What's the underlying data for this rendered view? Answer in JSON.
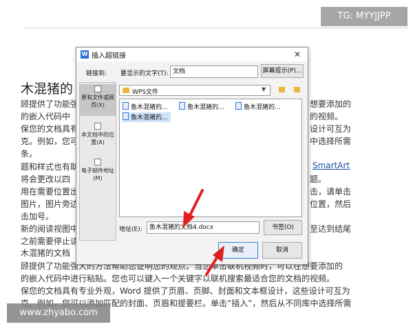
{
  "document": {
    "title": "木混猪的",
    "lines": [
      "顾提供了功能强",
      "的嵌入代码中",
      "保您的文档具有",
      "克。例如，您可",
      "条。",
      "题和样式也有助",
      "将会更改以四",
      "用在需要位置出",
      "图片，图片旁边",
      "击加号。",
      "新的阅读视图中",
      "之前需要停止读",
      "木混猪的文档",
      "顾提供了功能强大的方法帮助您证明您的观点。当您单击联机视频时，可以在想要添加的",
      "的嵌入代码中进行粘贴。您也可以键入一个关键字以联机搜索最适合您的文档的视频。",
      "保您的文档具有专业外观，Word 提供了页眉、页脚、封面和文本框设计，这些设计可互为",
      "克。例如，您可以添加匹配的封面、页眉和提要栏。单击“插入”，然后从不同库中选择所需"
    ],
    "right_fragments": [
      "想要添加的",
      "的视频。",
      "设计可互为",
      "中选择所需",
      "SmartArt",
      "题。",
      "击，请单击",
      "位置，然后",
      "至达到结尾"
    ]
  },
  "watermarks": {
    "tg": "TG: MYYJJPP",
    "site": "www.zhyabo.com"
  },
  "dialog": {
    "title": "插入超链接",
    "link_to_label": "链接到:",
    "display_text_label": "要显示的文字(T):",
    "display_text_value": "文档",
    "screen_tip_button": "屏幕提示(P)...",
    "panel_items": [
      {
        "label": "原有文件或网页(X)",
        "icon": "globe-file-icon",
        "selected": true
      },
      {
        "label": "本文档中的位置(A)",
        "icon": "bookmark-icon",
        "selected": false
      },
      {
        "label": "电子邮件地址(M)",
        "icon": "mail-icon",
        "selected": false
      }
    ],
    "folder": "WPS文件",
    "files": [
      {
        "name": "鱼木混猪的...",
        "selected": false
      },
      {
        "name": "鱼木混猪的...",
        "selected": false
      },
      {
        "name": "鱼木混猪的...",
        "selected": false
      },
      {
        "name": "鱼木混猪的...",
        "selected": true
      }
    ],
    "address_label": "地址(E):",
    "address_value": "鱼木混猪的文档4.docx",
    "bookmark_button": "书签(O)",
    "ok_button": "确定",
    "cancel_button": "取消"
  },
  "colors": {
    "accent": "#2f6fd6",
    "annotation_arrow": "#e02020"
  }
}
